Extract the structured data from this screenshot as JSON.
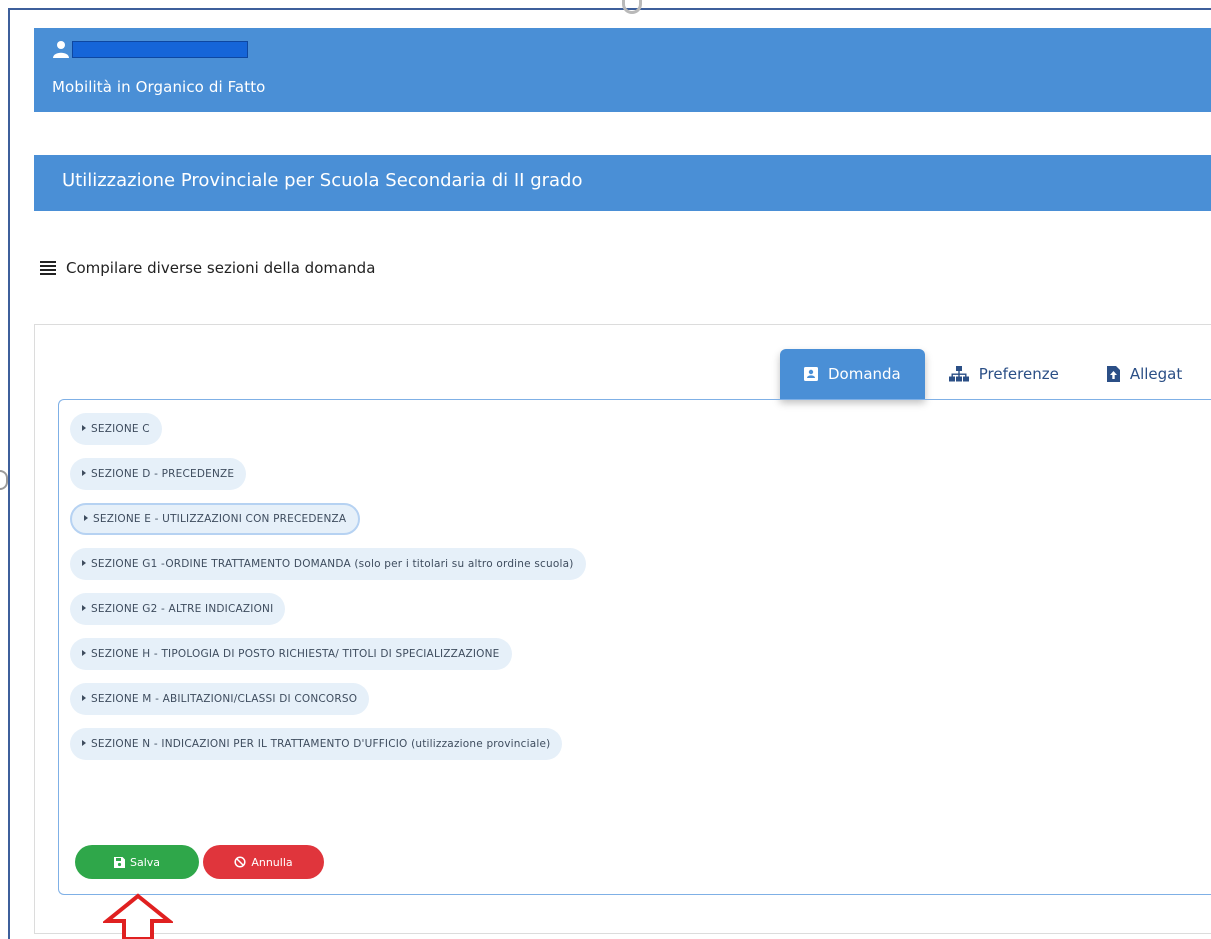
{
  "header": {
    "app_title": "Mobilità in Organico di Fatto"
  },
  "section_title": "Utilizzazione Provinciale per Scuola Secondaria di II grado",
  "instructions": "Compilare diverse sezioni della domanda",
  "tabs": [
    {
      "label": "Domanda",
      "icon": "address-card-icon",
      "active": true
    },
    {
      "label": "Preferenze",
      "icon": "sitemap-icon",
      "active": false
    },
    {
      "label": "Allegat",
      "icon": "file-upload-icon",
      "active": false
    }
  ],
  "sections": [
    "SEZIONE C",
    "SEZIONE D - PRECEDENZE",
    "SEZIONE E - UTILIZZAZIONI CON PRECEDENZA",
    "SEZIONE G1 -ORDINE TRATTAMENTO DOMANDA (solo per i titolari su altro ordine scuola)",
    "SEZIONE G2 - ALTRE INDICAZIONI",
    "SEZIONE H - TIPOLOGIA DI POSTO RICHIESTA/ TITOLI DI SPECIALIZZAZIONE",
    "SEZIONE M - ABILITAZIONI/CLASSI DI CONCORSO",
    "SEZIONE N - INDICAZIONI PER IL TRATTAMENTO D'UFFICIO (utilizzazione provinciale)"
  ],
  "buttons": {
    "save_label": "Salva",
    "cancel_label": "Annulla"
  },
  "colors": {
    "header_blue": "#4a8fd6",
    "save_green": "#2fa74a",
    "cancel_red": "#e0353c",
    "arrow_red": "#e02020"
  }
}
